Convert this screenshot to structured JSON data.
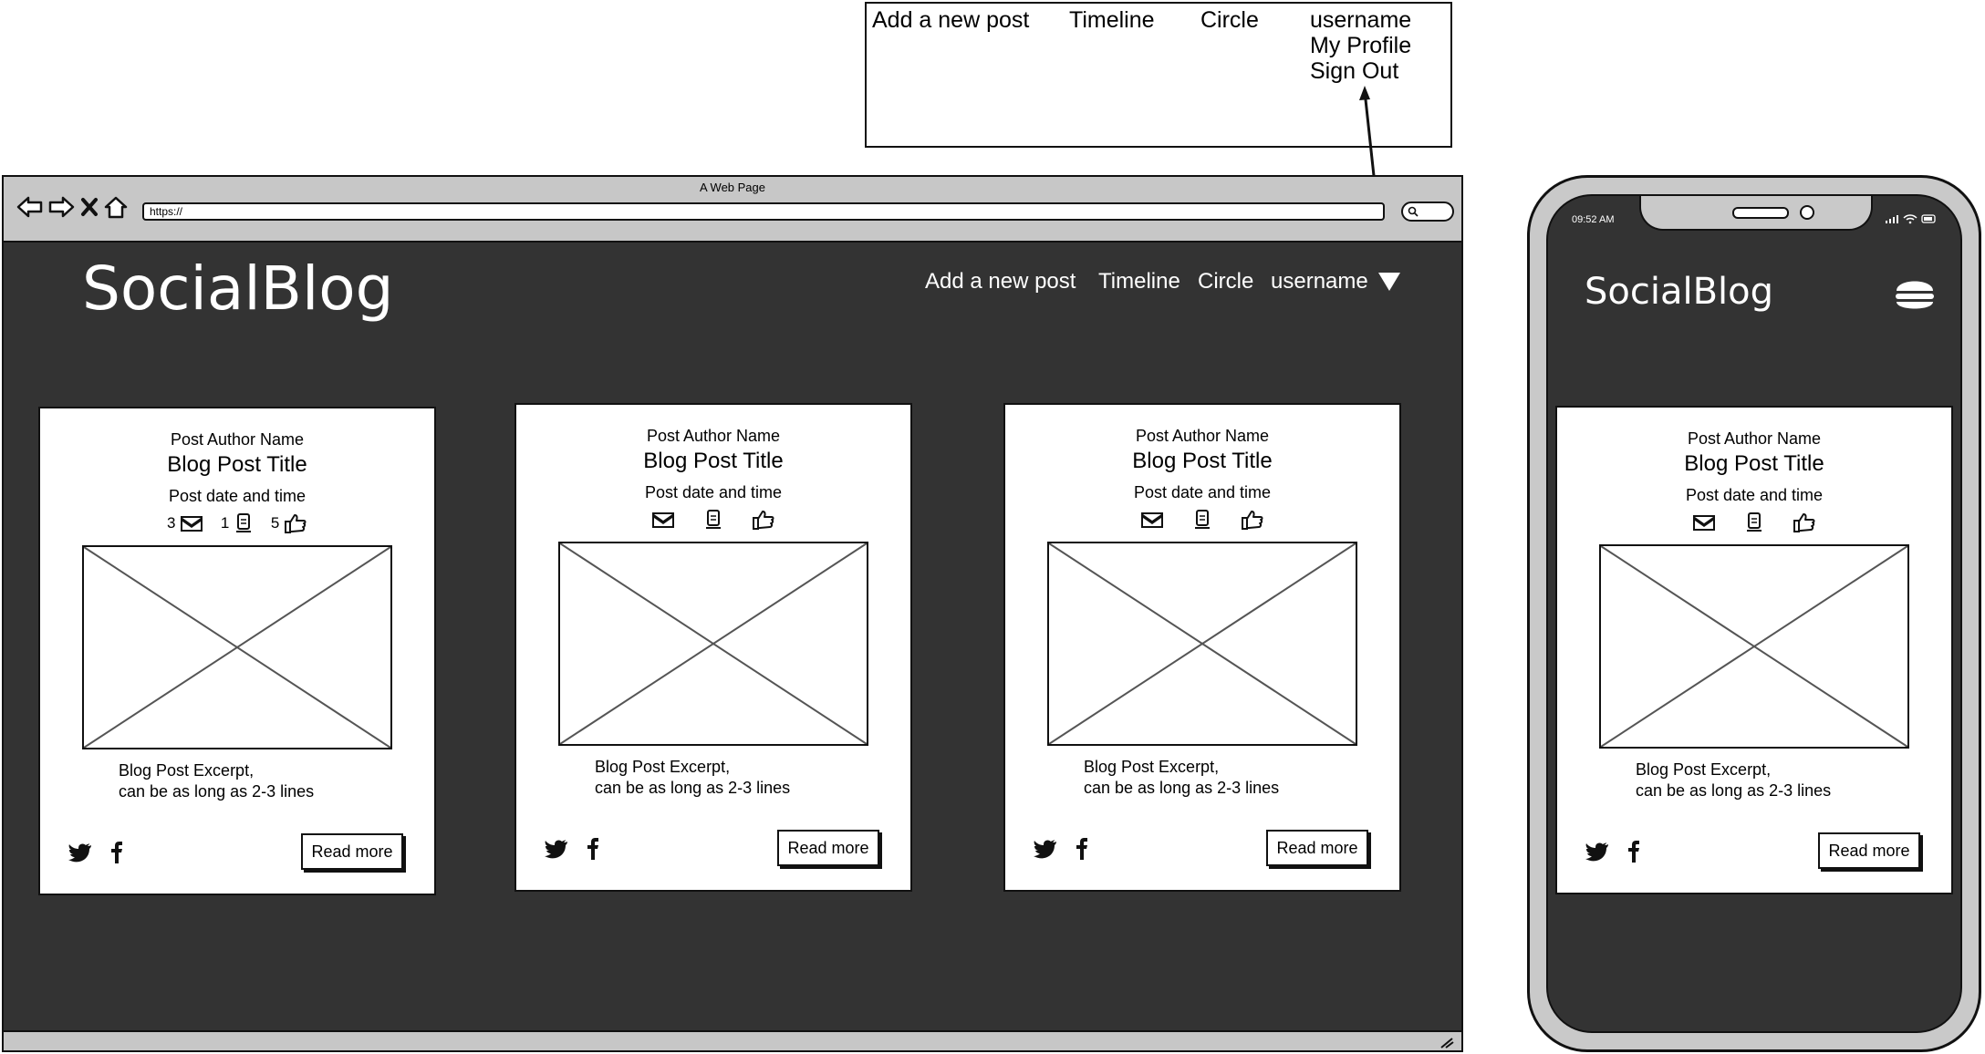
{
  "dropdown_mockup": {
    "items": [
      "Add a new post",
      "Timeline",
      "Circle",
      "username"
    ],
    "submenu": [
      "My Profile",
      "Sign Out"
    ]
  },
  "browser": {
    "window_title": "A Web Page",
    "url": "https://",
    "brand": "SocialBlog",
    "nav": {
      "add_post": "Add a new post",
      "timeline": "Timeline",
      "circle": "Circle",
      "username": "username"
    }
  },
  "cards": [
    {
      "author": "Post Author Name",
      "title": "Blog Post Title",
      "date": "Post date and time",
      "comments": "3",
      "bookmarks": "1",
      "likes": "5",
      "excerpt_line1": "Blog Post Excerpt,",
      "excerpt_line2": "can be as long as 2-3 lines",
      "read_more": "Read more"
    },
    {
      "author": "Post Author Name",
      "title": "Blog Post Title",
      "date": "Post date and time",
      "excerpt_line1": "Blog Post Excerpt,",
      "excerpt_line2": "can be as long as 2-3 lines",
      "read_more": "Read more"
    },
    {
      "author": "Post Author Name",
      "title": "Blog Post Title",
      "date": "Post date and time",
      "excerpt_line1": "Blog Post Excerpt,",
      "excerpt_line2": "can be as long as 2-3 lines",
      "read_more": "Read more"
    }
  ],
  "phone": {
    "time": "09:52 AM",
    "brand": "SocialBlog",
    "card": {
      "author": "Post Author Name",
      "title": "Blog Post Title",
      "date": "Post date and time",
      "excerpt_line1": "Blog Post Excerpt,",
      "excerpt_line2": "can be as long as 2-3 lines",
      "read_more": "Read more"
    }
  },
  "icons": [
    "back-arrow-icon",
    "forward-arrow-icon",
    "stop-icon",
    "home-icon",
    "search-icon",
    "dropdown-triangle-icon",
    "comment-icon",
    "bookmark-icon",
    "thumbs-up-icon",
    "twitter-icon",
    "facebook-icon",
    "hamburger-menu-icon",
    "resize-grip-icon"
  ],
  "colors": {
    "page_background": "#333333",
    "chrome": "#c7c7c7",
    "card": "#ffffff",
    "text_on_dark": "#ffffff"
  }
}
